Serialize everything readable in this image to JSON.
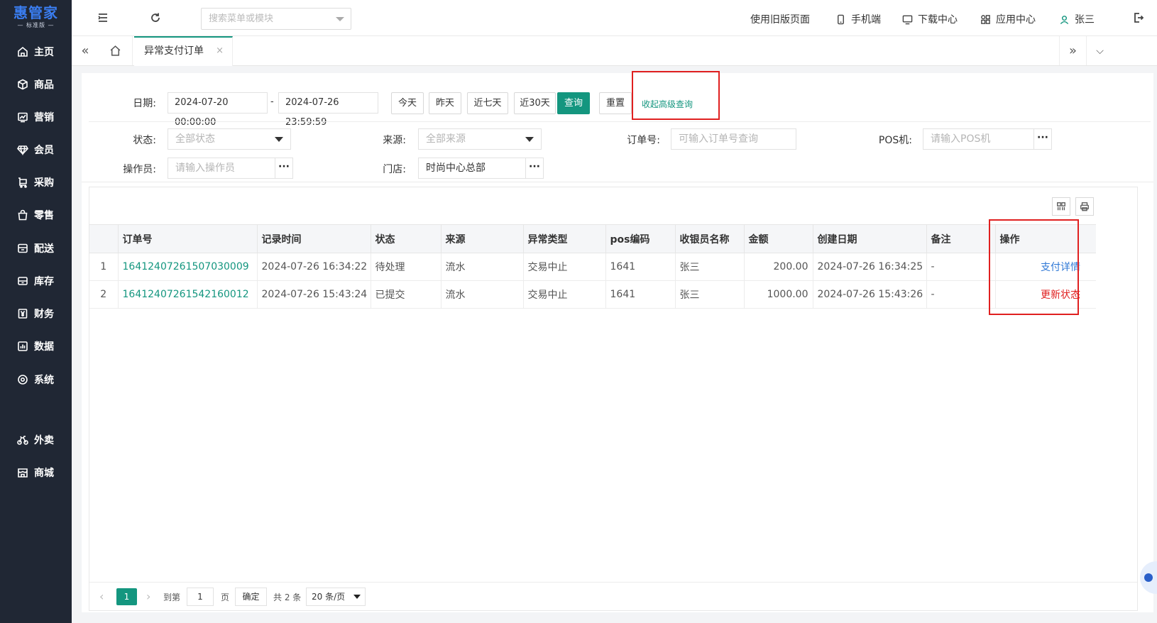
{
  "brand": {
    "name": "惠管家",
    "edition": "标准版"
  },
  "sidebar": {
    "items": [
      {
        "label": "主页",
        "icon": "home-icon"
      },
      {
        "label": "商品",
        "icon": "box-icon"
      },
      {
        "label": "营销",
        "icon": "chart-icon"
      },
      {
        "label": "会员",
        "icon": "diamond-icon"
      },
      {
        "label": "采购",
        "icon": "cart-icon"
      },
      {
        "label": "零售",
        "icon": "bag-icon"
      },
      {
        "label": "配送",
        "icon": "truck-icon"
      },
      {
        "label": "库存",
        "icon": "storage-icon"
      },
      {
        "label": "财务",
        "icon": "yen-icon"
      },
      {
        "label": "数据",
        "icon": "bar-chart-icon"
      },
      {
        "label": "系统",
        "icon": "settings-icon"
      },
      {
        "label": "外卖",
        "icon": "bike-icon"
      },
      {
        "label": "商城",
        "icon": "shop-icon"
      }
    ]
  },
  "header": {
    "menu_search_placeholder": "搜索菜单或模块",
    "links": {
      "old_version": "使用旧版页面",
      "mobile": "手机端",
      "download": "下载中心",
      "apps": "应用中心",
      "user": "张三"
    }
  },
  "tabs": {
    "active_label": "异常支付订单",
    "close": "×"
  },
  "filters": {
    "date_label": "日期:",
    "date_start": "2024-07-20 00:00:00",
    "date_sep": "-",
    "date_end": "2024-07-26 23:59:59",
    "quick_buttons": [
      "今天",
      "昨天",
      "近七天",
      "近30天"
    ],
    "query_button": "查询",
    "reset_button": "重置",
    "advanced_toggle": "收起高级查询",
    "status_label": "状态:",
    "status_value": "全部状态",
    "source_label": "来源:",
    "source_value": "全部来源",
    "order_no_label": "订单号:",
    "order_no_placeholder": "可输入订单号查询",
    "pos_label": "POS机:",
    "pos_placeholder": "请输入POS机",
    "operator_label": "操作员:",
    "operator_placeholder": "请输入操作员",
    "store_label": "门店:",
    "store_value": "时尚中心总部",
    "more": "···"
  },
  "table": {
    "columns": [
      "订单号",
      "记录时间",
      "状态",
      "来源",
      "异常类型",
      "pos编码",
      "收银员名称",
      "金额",
      "创建日期",
      "备注",
      "操作"
    ],
    "rows": [
      {
        "index": "1",
        "order_no": "16412407261507030009",
        "record_time": "2024-07-26 16:34:22",
        "status": "待处理",
        "source": "流水",
        "exception_type": "交易中止",
        "pos_code": "1641",
        "cashier": "张三",
        "amount": "200.00",
        "created": "2024-07-26 16:34:25",
        "remark": "-",
        "action": "支付详情",
        "action_color": "#2f78d6"
      },
      {
        "index": "2",
        "order_no": "16412407261542160012",
        "record_time": "2024-07-26 15:43:24",
        "status": "已提交",
        "source": "流水",
        "exception_type": "交易中止",
        "pos_code": "1641",
        "cashier": "张三",
        "amount": "1000.00",
        "created": "2024-07-26 15:43:26",
        "remark": "-",
        "action": "更新状态",
        "action_color": "#e02020"
      }
    ]
  },
  "pagination": {
    "current_page": "1",
    "goto_label": "到第",
    "goto_value": "1",
    "page_unit": "页",
    "confirm": "确定",
    "total": "共 2 条",
    "page_size": "20 条/页"
  },
  "colors": {
    "accent": "#14967f",
    "sidebar_bg": "#202734",
    "highlight_box": "#e02020"
  }
}
